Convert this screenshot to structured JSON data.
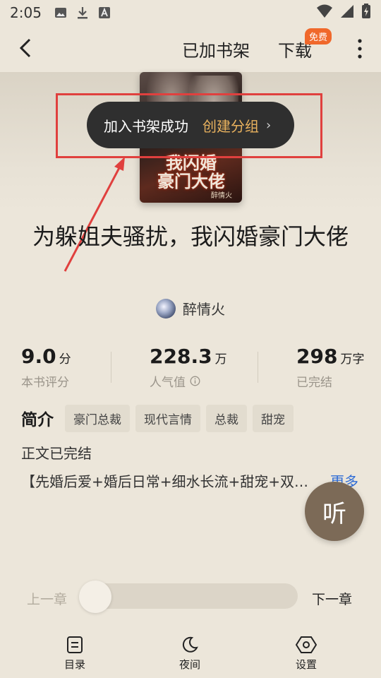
{
  "status_bar": {
    "time": "2:05"
  },
  "header": {
    "shelf_label": "已加书架",
    "download_label": "下载",
    "free_badge": "免费"
  },
  "cover": {
    "title_line1": "我闪婚",
    "title_line2": "豪门大佬",
    "author_small": "醉情火"
  },
  "toast": {
    "message": "加入书架成功",
    "action": "创建分组",
    "chevron": "›"
  },
  "book": {
    "title": "为躲姐夫骚扰，我闪婚豪门大佬",
    "author": "醉情火"
  },
  "stats": [
    {
      "value": "9.0",
      "unit": "分",
      "label": "本书评分"
    },
    {
      "value": "228.3",
      "unit": "万",
      "label": "人气值"
    },
    {
      "value": "298",
      "unit": "万字",
      "label": "已完结"
    }
  ],
  "intro": {
    "heading": "简介",
    "tags": [
      "豪门总裁",
      "现代言情",
      "总裁",
      "甜宠"
    ],
    "status": "正文已完结",
    "synopsis": "【先婚后爱+婚后日常+细水长流+甜宠+双洁…",
    "more": "更多"
  },
  "listen_label": "听",
  "reader": {
    "prev": "上一章",
    "next": "下一章",
    "progress": 0
  },
  "bottom_nav": [
    {
      "label": "目录",
      "icon": "catalog-icon"
    },
    {
      "label": "夜间",
      "icon": "moon-icon"
    },
    {
      "label": "设置",
      "icon": "settings-icon"
    }
  ],
  "colors": {
    "background": "#ECE6DA",
    "toast_bg": "#2F2F2F",
    "toast_action": "#E9B25E",
    "badge": "#F0682B",
    "annotation": "#E0403E",
    "link": "#2E6CD6",
    "listen_button": "#7C6A57"
  }
}
